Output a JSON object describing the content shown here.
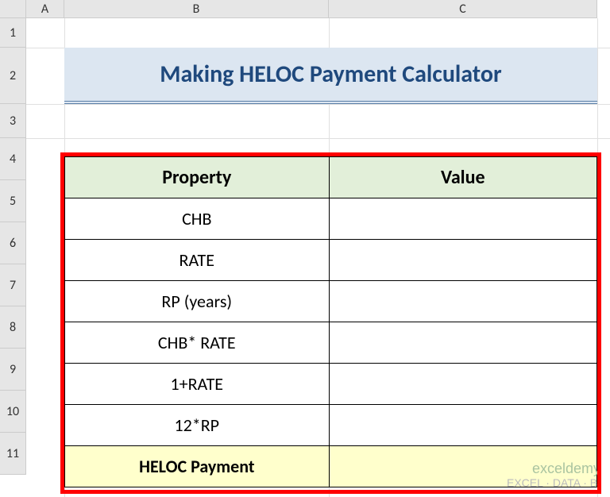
{
  "columns": {
    "A": "A",
    "B": "B",
    "C": "C"
  },
  "rows": {
    "r1": "1",
    "r2": "2",
    "r3": "3",
    "r4": "4",
    "r5": "5",
    "r6": "6",
    "r7": "7",
    "r8": "8",
    "r9": "9",
    "r10": "10",
    "r11": "11"
  },
  "title": "Making HELOC Payment Calculator",
  "headers": {
    "property": "Property",
    "value": "Value"
  },
  "rows_data": {
    "r5": {
      "property": "CHB",
      "value": ""
    },
    "r6": {
      "property": "RATE",
      "value": ""
    },
    "r7": {
      "property": "RP (years)",
      "value": ""
    },
    "r8": {
      "property": "CHB* RATE",
      "value": ""
    },
    "r9": {
      "property": "1+RATE",
      "value": ""
    },
    "r10": {
      "property": "12*RP",
      "value": ""
    },
    "r11": {
      "property": "HELOC Payment",
      "value": ""
    }
  },
  "watermark": {
    "line1": "exceldemy",
    "line2": "EXCEL · DATA · BI"
  },
  "chart_data": {
    "type": "table",
    "title": "Making HELOC Payment Calculator",
    "columns": [
      "Property",
      "Value"
    ],
    "rows": [
      [
        "CHB",
        ""
      ],
      [
        "RATE",
        ""
      ],
      [
        "RP (years)",
        ""
      ],
      [
        "CHB* RATE",
        ""
      ],
      [
        "1+RATE",
        ""
      ],
      [
        "12*RP",
        ""
      ],
      [
        "HELOC Payment",
        ""
      ]
    ]
  }
}
